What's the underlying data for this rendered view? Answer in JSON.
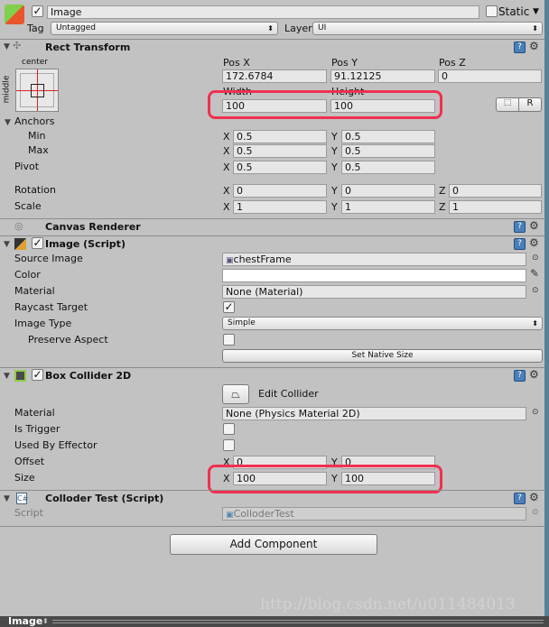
{
  "object": {
    "name": "Image",
    "active": true,
    "static_label": "Static",
    "tag_label": "Tag",
    "tag": "Untagged",
    "layer_label": "Layer",
    "layer": "UI"
  },
  "rect_transform": {
    "title": "Rect Transform",
    "anchor_h": "center",
    "anchor_v": "middle",
    "pos_x_label": "Pos X",
    "pos_y_label": "Pos Y",
    "pos_z_label": "Pos Z",
    "pos_x": "172.6784",
    "pos_y": "91.12125",
    "pos_z": "0",
    "width_label": "Width",
    "height_label": "Height",
    "width": "100",
    "height": "100",
    "raw_label": "R",
    "anchors_label": "Anchors",
    "min_label": "Min",
    "max_label": "Max",
    "pivot_label": "Pivot",
    "min_x": "0.5",
    "min_y": "0.5",
    "max_x": "0.5",
    "max_y": "0.5",
    "pivot_x": "0.5",
    "pivot_y": "0.5",
    "rotation_label": "Rotation",
    "rot_x": "0",
    "rot_y": "0",
    "rot_z": "0",
    "scale_label": "Scale",
    "scale_x": "1",
    "scale_y": "1",
    "scale_z": "1",
    "x": "X",
    "y": "Y",
    "z": "Z"
  },
  "canvas_renderer": {
    "title": "Canvas Renderer"
  },
  "image": {
    "title": "Image (Script)",
    "enabled": true,
    "source_label": "Source Image",
    "source": "chestFrame",
    "color_label": "Color",
    "color": "#ffffff",
    "material_label": "Material",
    "material": "None (Material)",
    "raycast_label": "Raycast Target",
    "raycast": true,
    "type_label": "Image Type",
    "type": "Simple",
    "preserve_label": "Preserve Aspect",
    "preserve": false,
    "native_btn": "Set Native Size"
  },
  "box_collider": {
    "title": "Box Collider 2D",
    "enabled": true,
    "edit_label": "Edit Collider",
    "material_label": "Material",
    "material": "None (Physics Material 2D)",
    "trigger_label": "Is Trigger",
    "effector_label": "Used By Effector",
    "offset_label": "Offset",
    "offset_x": "0",
    "offset_y": "0",
    "size_label": "Size",
    "size_x": "100",
    "size_y": "100"
  },
  "script": {
    "title": "Colloder Test (Script)",
    "script_label": "Script",
    "script": "ColloderTest"
  },
  "add_component": "Add Component",
  "bottom": {
    "label": "Image"
  },
  "watermark": "http://blog.csdn.net/u011484013"
}
